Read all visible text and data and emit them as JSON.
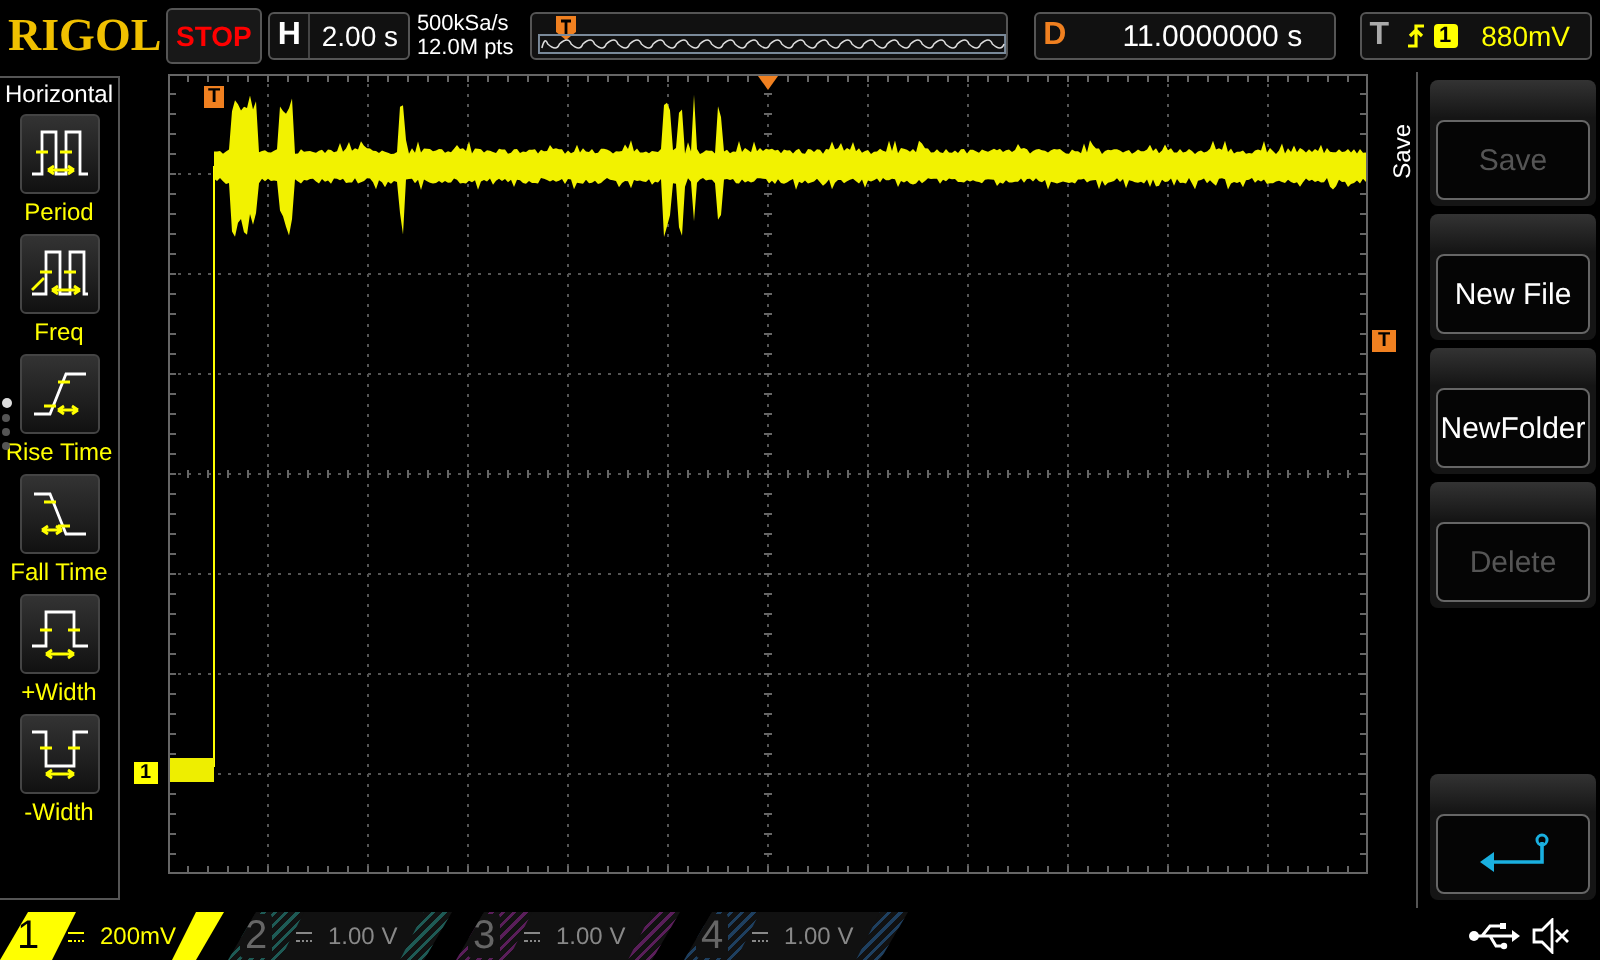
{
  "brand": "RIGOL",
  "run_state": "STOP",
  "horizontal": {
    "label": "H",
    "timebase": "2.00 s"
  },
  "acquisition": {
    "sample_rate": "500kSa/s",
    "memory_depth": "12.0M pts"
  },
  "delay": {
    "label": "D",
    "value": "11.0000000 s"
  },
  "trigger": {
    "label": "T",
    "source": "1",
    "level": "880mV"
  },
  "markers": {
    "trigger_position": "T",
    "channel": "1",
    "trigger_level": "T"
  },
  "left_menu": {
    "title": "Horizontal",
    "items": [
      {
        "kind": "period",
        "label": "Period"
      },
      {
        "kind": "freq",
        "label": "Freq"
      },
      {
        "kind": "rise",
        "label": "Rise Time"
      },
      {
        "kind": "fall",
        "label": "Fall Time"
      },
      {
        "kind": "pwidth",
        "label": "+Width"
      },
      {
        "kind": "nwidth",
        "label": "-Width"
      }
    ],
    "page_dots": [
      {
        "selected": true
      },
      {
        "selected": false
      },
      {
        "selected": false
      },
      {
        "selected": false
      }
    ]
  },
  "right_menu": {
    "title": "Save",
    "buttons": [
      {
        "kind": "text",
        "label": "Save",
        "disabled": true
      },
      {
        "kind": "text",
        "label": "New File",
        "disabled": false
      },
      {
        "kind": "text",
        "label": "NewFolder",
        "disabled": false
      },
      {
        "kind": "text",
        "label": "Delete",
        "disabled": true
      },
      {
        "kind": "back",
        "disabled": false
      }
    ]
  },
  "channels": [
    {
      "label": "1",
      "scale": "200mV",
      "on": true,
      "color": "#ffff00"
    },
    {
      "label": "2",
      "scale": "1.00 V",
      "on": false,
      "color": "#1e5a55"
    },
    {
      "label": "3",
      "scale": "1.00 V",
      "on": false,
      "color": "#5a1e5a"
    },
    {
      "label": "4",
      "scale": "1.00 V",
      "on": false,
      "color": "#1e3f5f"
    }
  ]
}
